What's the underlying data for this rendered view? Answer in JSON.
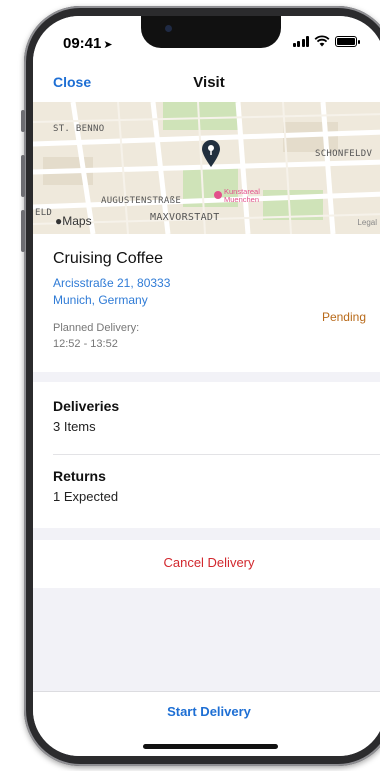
{
  "status_bar": {
    "time": "09:41",
    "location_arrow": "location-arrow-icon"
  },
  "nav": {
    "close_label": "Close",
    "title": "Visit"
  },
  "map": {
    "labels": {
      "st_benno": "ST. BENNO",
      "schonfeld": "SCHONFELDV",
      "augusten": "AUGUSTENSTRAßE",
      "maxvorstadt": "MAXVORSTADT",
      "eld": "ELD"
    },
    "poi_line1": "Kunstareal",
    "poi_line2": "Muenchen",
    "maps_label": "Maps",
    "legal_label": "Legal",
    "pin_icon": "map-pin-icon"
  },
  "visit": {
    "name": "Cruising Coffee",
    "address_line1": "Arcisstraße 21, 80333",
    "address_line2": "Munich, Germany",
    "status": "Pending",
    "planned_label": "Planned Delivery:",
    "planned_time": "12:52 - 13:52"
  },
  "deliveries": {
    "heading": "Deliveries",
    "value": "3 Items"
  },
  "returns": {
    "heading": "Returns",
    "value": "1 Expected"
  },
  "actions": {
    "cancel_label": "Cancel Delivery",
    "start_label": "Start Delivery"
  },
  "colors": {
    "accent": "#1e6fd4",
    "destructive": "#d2282e",
    "pending": "#b86a1a"
  }
}
